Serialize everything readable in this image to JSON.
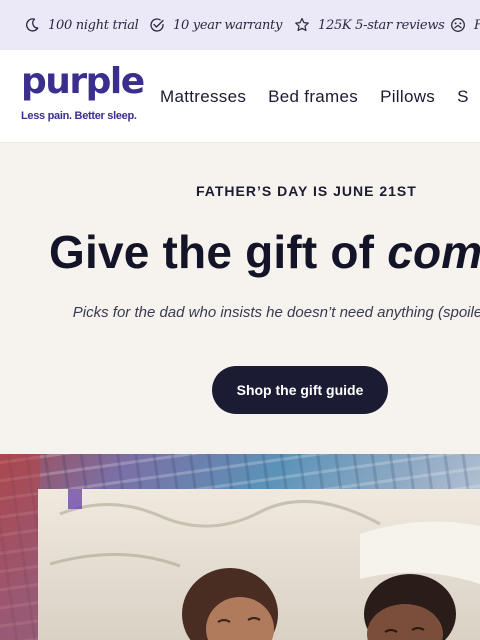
{
  "promo_bar": {
    "items": [
      {
        "icon": "moon-icon",
        "text": "100 night trial"
      },
      {
        "icon": "check-circle-icon",
        "text": "10 year warranty"
      },
      {
        "icon": "star-icon",
        "text": "125K 5-star reviews"
      },
      {
        "icon": "wheel-icon",
        "text": "F"
      }
    ]
  },
  "header": {
    "logo_text": "purple",
    "tagline": "Less pain. Better sleep.",
    "nav": [
      "Mattresses",
      "Bed frames",
      "Pillows",
      "S"
    ]
  },
  "hero": {
    "eyebrow": "FATHER’S DAY IS JUNE 21ST",
    "headline_plain": "Give the gift of ",
    "headline_italic": "com",
    "subtext": "Picks for the dad who insists he doesn’t need anything (spoile these.",
    "cta_label": "Shop the gift guide"
  },
  "colors": {
    "promo_bg": "#ebe8f7",
    "brand_purple": "#3b2f8e",
    "hero_bg": "#f6f3ee",
    "cta_bg": "#1b1b34"
  }
}
